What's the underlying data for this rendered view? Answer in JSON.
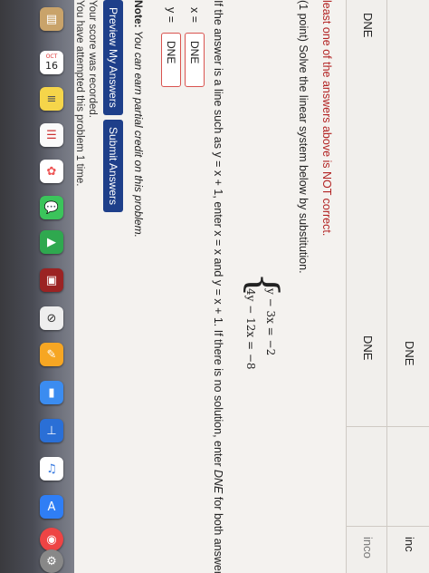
{
  "dock": {
    "calendar_day": "16",
    "calendar_month": "OCT"
  },
  "previous_attempt": {
    "row1": [
      "DNE",
      "inc"
    ],
    "row2": [
      "DNE",
      "DNE",
      "inco"
    ]
  },
  "warning": "least one of the answers above is NOT correct.",
  "problem": {
    "prompt": "(1 point) Solve the linear system below by substitution.",
    "equation1": "y − 3x   =   −2",
    "equation2": "4y − 12x   =   −8",
    "instructions_a": "If the answer is a line such as y = x + 1, enter x = x and y = x + 1. If there is no solution, enter ",
    "instructions_dne": "DNE",
    "instructions_b": " for both answers."
  },
  "answers": {
    "x_label": "x =",
    "x_value": "DNE",
    "y_label": "y =",
    "y_value": "DNE"
  },
  "note_bold": "Note:",
  "note_text": " You can earn partial credit on this problem.",
  "buttons": {
    "preview": "Preview My Answers",
    "submit": "Submit Answers"
  },
  "status": {
    "recorded": "Your score was recorded.",
    "attempts": "You have attempted this problem 1 time."
  }
}
